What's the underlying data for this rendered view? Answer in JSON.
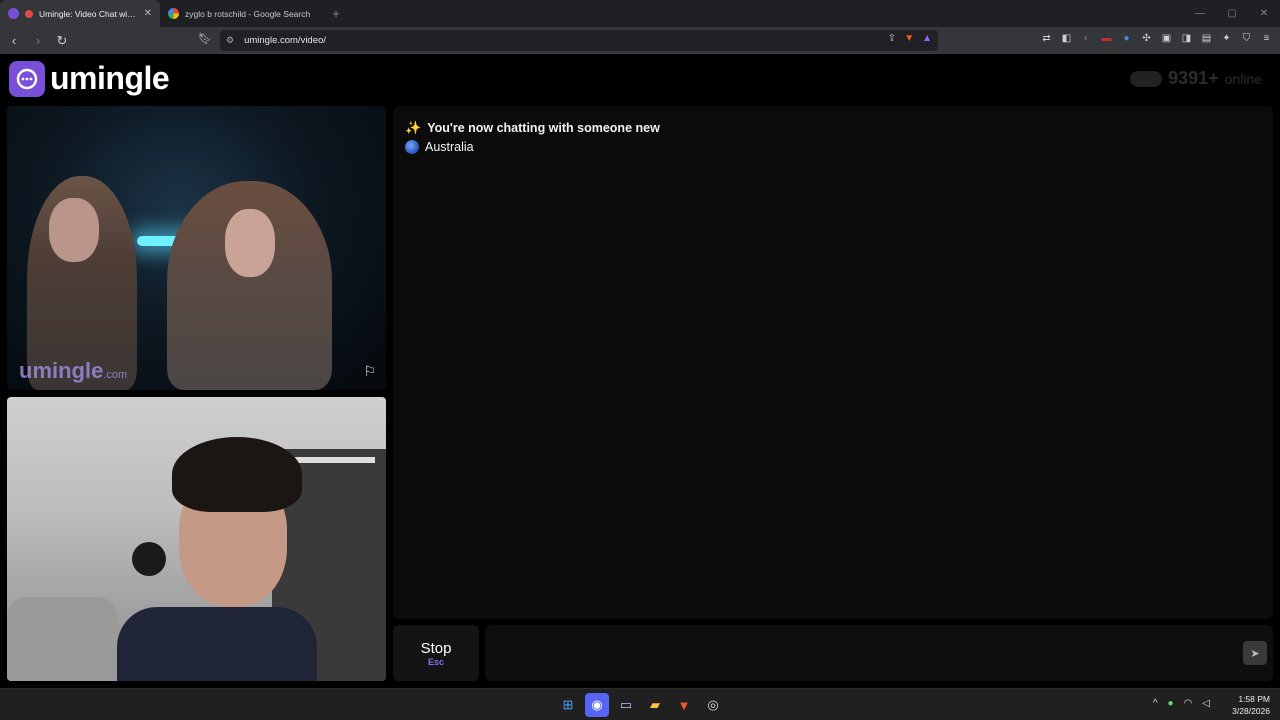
{
  "browser": {
    "tabs": [
      {
        "title": "Umingle: Video Chat with Str",
        "active": true
      },
      {
        "title": "zyglo b rotschild - Google Search",
        "active": false
      }
    ],
    "url": "umingle.com/video/"
  },
  "site": {
    "logo_text": "umingle",
    "online_count": "9391+",
    "online_label": "online"
  },
  "remote_video": {
    "watermark_main": "umingle",
    "watermark_suffix": ".com"
  },
  "chat": {
    "message": "You're now chatting with someone new",
    "country": "Australia"
  },
  "controls": {
    "stop_label": "Stop",
    "stop_key": "Esc",
    "message_placeholder": ""
  },
  "taskbar": {
    "time": "1:58 PM",
    "date": "3/28/2026"
  },
  "colors": {
    "accent": "#7a4fd8",
    "background": "#000000",
    "panel": "#0b0b0b"
  }
}
